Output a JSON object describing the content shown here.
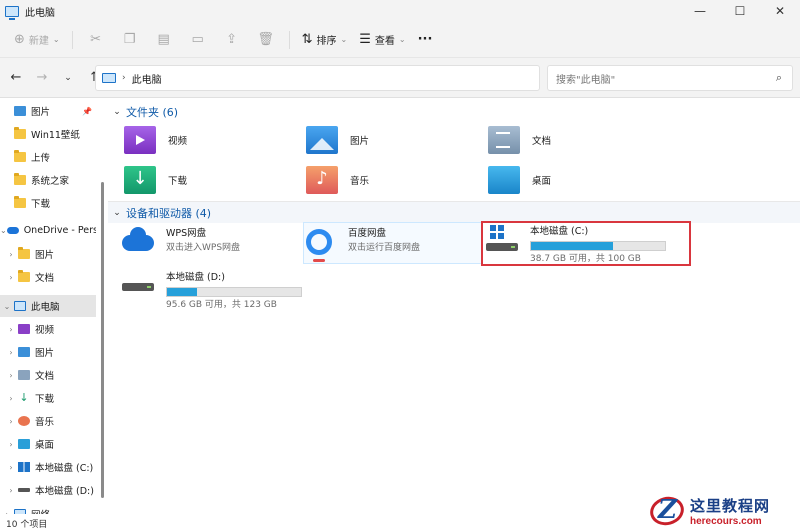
{
  "window": {
    "title": "此电脑",
    "minimize": "—",
    "maximize": "☐",
    "close": "✕"
  },
  "toolbar": {
    "new_label": "新建",
    "sort_label": "排序",
    "view_label": "查看",
    "more": "···"
  },
  "address": {
    "path": "此电脑",
    "search_placeholder": "搜索\"此电脑\""
  },
  "sidebar": {
    "items": [
      {
        "label": "图片",
        "icon": "pictures-icon",
        "pinned": true
      },
      {
        "label": "Win11壁纸",
        "icon": "folder-icon"
      },
      {
        "label": "上传",
        "icon": "folder-icon"
      },
      {
        "label": "系统之家",
        "icon": "folder-icon"
      },
      {
        "label": "下载",
        "icon": "folder-icon"
      },
      {
        "label": "OneDrive - Pers",
        "icon": "cloud-icon"
      },
      {
        "label": "图片",
        "icon": "folder-icon"
      },
      {
        "label": "文档",
        "icon": "folder-icon"
      },
      {
        "label": "此电脑",
        "icon": "pc-icon",
        "selected": true
      },
      {
        "label": "视频",
        "icon": "video-icon"
      },
      {
        "label": "图片",
        "icon": "pictures-icon"
      },
      {
        "label": "文档",
        "icon": "documents-icon"
      },
      {
        "label": "下载",
        "icon": "download-icon"
      },
      {
        "label": "音乐",
        "icon": "music-icon"
      },
      {
        "label": "桌面",
        "icon": "desktop-icon"
      },
      {
        "label": "本地磁盘 (C:)",
        "icon": "windows-drive-icon"
      },
      {
        "label": "本地磁盘 (D:)",
        "icon": "drive-icon"
      },
      {
        "label": "网络",
        "icon": "network-icon"
      }
    ]
  },
  "main": {
    "folders_header": "文件夹 (6)",
    "folders": [
      {
        "label": "视频",
        "icon": "video-folder-icon"
      },
      {
        "label": "图片",
        "icon": "pictures-folder-icon"
      },
      {
        "label": "文档",
        "icon": "documents-folder-icon"
      },
      {
        "label": "下载",
        "icon": "downloads-folder-icon"
      },
      {
        "label": "音乐",
        "icon": "music-folder-icon"
      },
      {
        "label": "桌面",
        "icon": "desktop-folder-icon"
      }
    ],
    "devices_header": "设备和驱动器 (4)",
    "devices": [
      {
        "name": "WPS网盘",
        "sub": "双击进入WPS网盘",
        "icon": "wps-cloud-icon"
      },
      {
        "name": "百度网盘",
        "sub": "双击运行百度网盘",
        "icon": "baidu-netdisk-icon"
      },
      {
        "name": "本地磁盘 (C:)",
        "sub": "38.7 GB 可用，共 100 GB",
        "icon": "windows-drive-icon",
        "used_fraction": 0.613
      },
      {
        "name": "本地磁盘 (D:)",
        "sub": "95.6 GB 可用，共 123 GB",
        "icon": "drive-icon",
        "used_fraction": 0.223
      }
    ]
  },
  "status": {
    "count": "10 个项目"
  },
  "watermark": {
    "cn": "这里教程网",
    "en": "herecours.com"
  },
  "colors": {
    "accent": "#1d73c8",
    "bar_fill": "#26a0da",
    "highlight_box": "#d9363e"
  }
}
